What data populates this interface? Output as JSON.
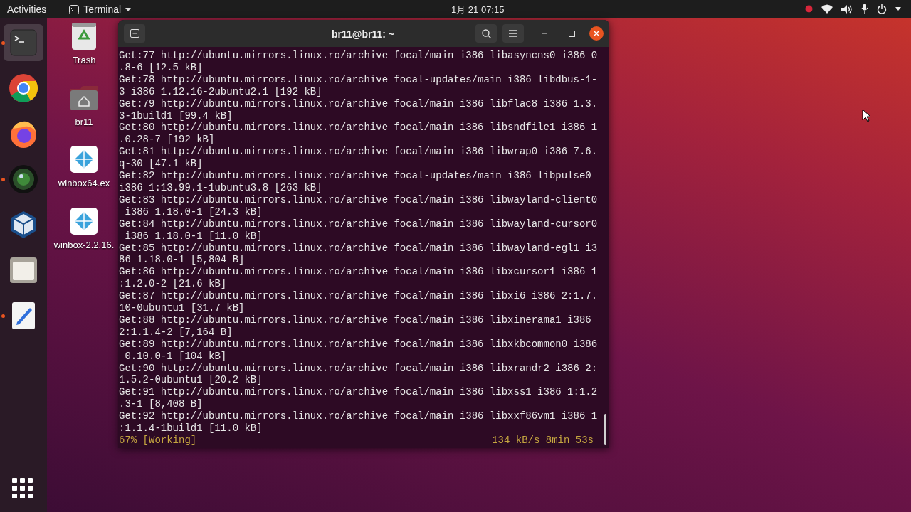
{
  "top_bar": {
    "activities": "Activities",
    "app_menu": "Terminal",
    "clock": "1月 21 07:15"
  },
  "dock": [
    {
      "kind": "terminal",
      "selected": true,
      "running": true
    },
    {
      "kind": "chrome",
      "selected": false,
      "running": false
    },
    {
      "kind": "firefox",
      "selected": false,
      "running": false
    },
    {
      "kind": "camera",
      "selected": false,
      "running": true
    },
    {
      "kind": "virtualbox",
      "selected": false,
      "running": false
    },
    {
      "kind": "files",
      "selected": false,
      "running": false
    },
    {
      "kind": "editor",
      "selected": false,
      "running": true
    }
  ],
  "desktop_icons": [
    {
      "kind": "trash",
      "label": "Trash"
    },
    {
      "kind": "home",
      "label": "br11"
    },
    {
      "kind": "winbox",
      "label": "winbox64.ex"
    },
    {
      "kind": "winbox",
      "label": "winbox-2.2.16."
    }
  ],
  "terminal": {
    "title": "br11@br11: ~",
    "lines": [
      "Get:77 http://ubuntu.mirrors.linux.ro/archive focal/main i386 libasyncns0 i386 0",
      ".8-6 [12.5 kB]",
      "Get:78 http://ubuntu.mirrors.linux.ro/archive focal-updates/main i386 libdbus-1-",
      "3 i386 1.12.16-2ubuntu2.1 [192 kB]",
      "Get:79 http://ubuntu.mirrors.linux.ro/archive focal/main i386 libflac8 i386 1.3.",
      "3-1build1 [99.4 kB]",
      "Get:80 http://ubuntu.mirrors.linux.ro/archive focal/main i386 libsndfile1 i386 1",
      ".0.28-7 [192 kB]",
      "Get:81 http://ubuntu.mirrors.linux.ro/archive focal/main i386 libwrap0 i386 7.6.",
      "q-30 [47.1 kB]",
      "Get:82 http://ubuntu.mirrors.linux.ro/archive focal-updates/main i386 libpulse0",
      "i386 1:13.99.1-1ubuntu3.8 [263 kB]",
      "Get:83 http://ubuntu.mirrors.linux.ro/archive focal/main i386 libwayland-client0",
      " i386 1.18.0-1 [24.3 kB]",
      "Get:84 http://ubuntu.mirrors.linux.ro/archive focal/main i386 libwayland-cursor0",
      " i386 1.18.0-1 [11.0 kB]",
      "Get:85 http://ubuntu.mirrors.linux.ro/archive focal/main i386 libwayland-egl1 i3",
      "86 1.18.0-1 [5,804 B]",
      "Get:86 http://ubuntu.mirrors.linux.ro/archive focal/main i386 libxcursor1 i386 1",
      ":1.2.0-2 [21.6 kB]",
      "Get:87 http://ubuntu.mirrors.linux.ro/archive focal/main i386 libxi6 i386 2:1.7.",
      "10-0ubuntu1 [31.7 kB]",
      "Get:88 http://ubuntu.mirrors.linux.ro/archive focal/main i386 libxinerama1 i386",
      "2:1.1.4-2 [7,164 B]",
      "Get:89 http://ubuntu.mirrors.linux.ro/archive focal/main i386 libxkbcommon0 i386",
      " 0.10.0-1 [104 kB]",
      "Get:90 http://ubuntu.mirrors.linux.ro/archive focal/main i386 libxrandr2 i386 2:",
      "1.5.2-0ubuntu1 [20.2 kB]",
      "Get:91 http://ubuntu.mirrors.linux.ro/archive focal/main i386 libxss1 i386 1:1.2",
      ".3-1 [8,408 B]",
      "Get:92 http://ubuntu.mirrors.linux.ro/archive focal/main i386 libxxf86vm1 i386 1",
      ":1.1.4-1build1 [11.0 kB]"
    ],
    "status_left": "67% [Working]",
    "status_right": "134 kB/s 8min 53s"
  }
}
